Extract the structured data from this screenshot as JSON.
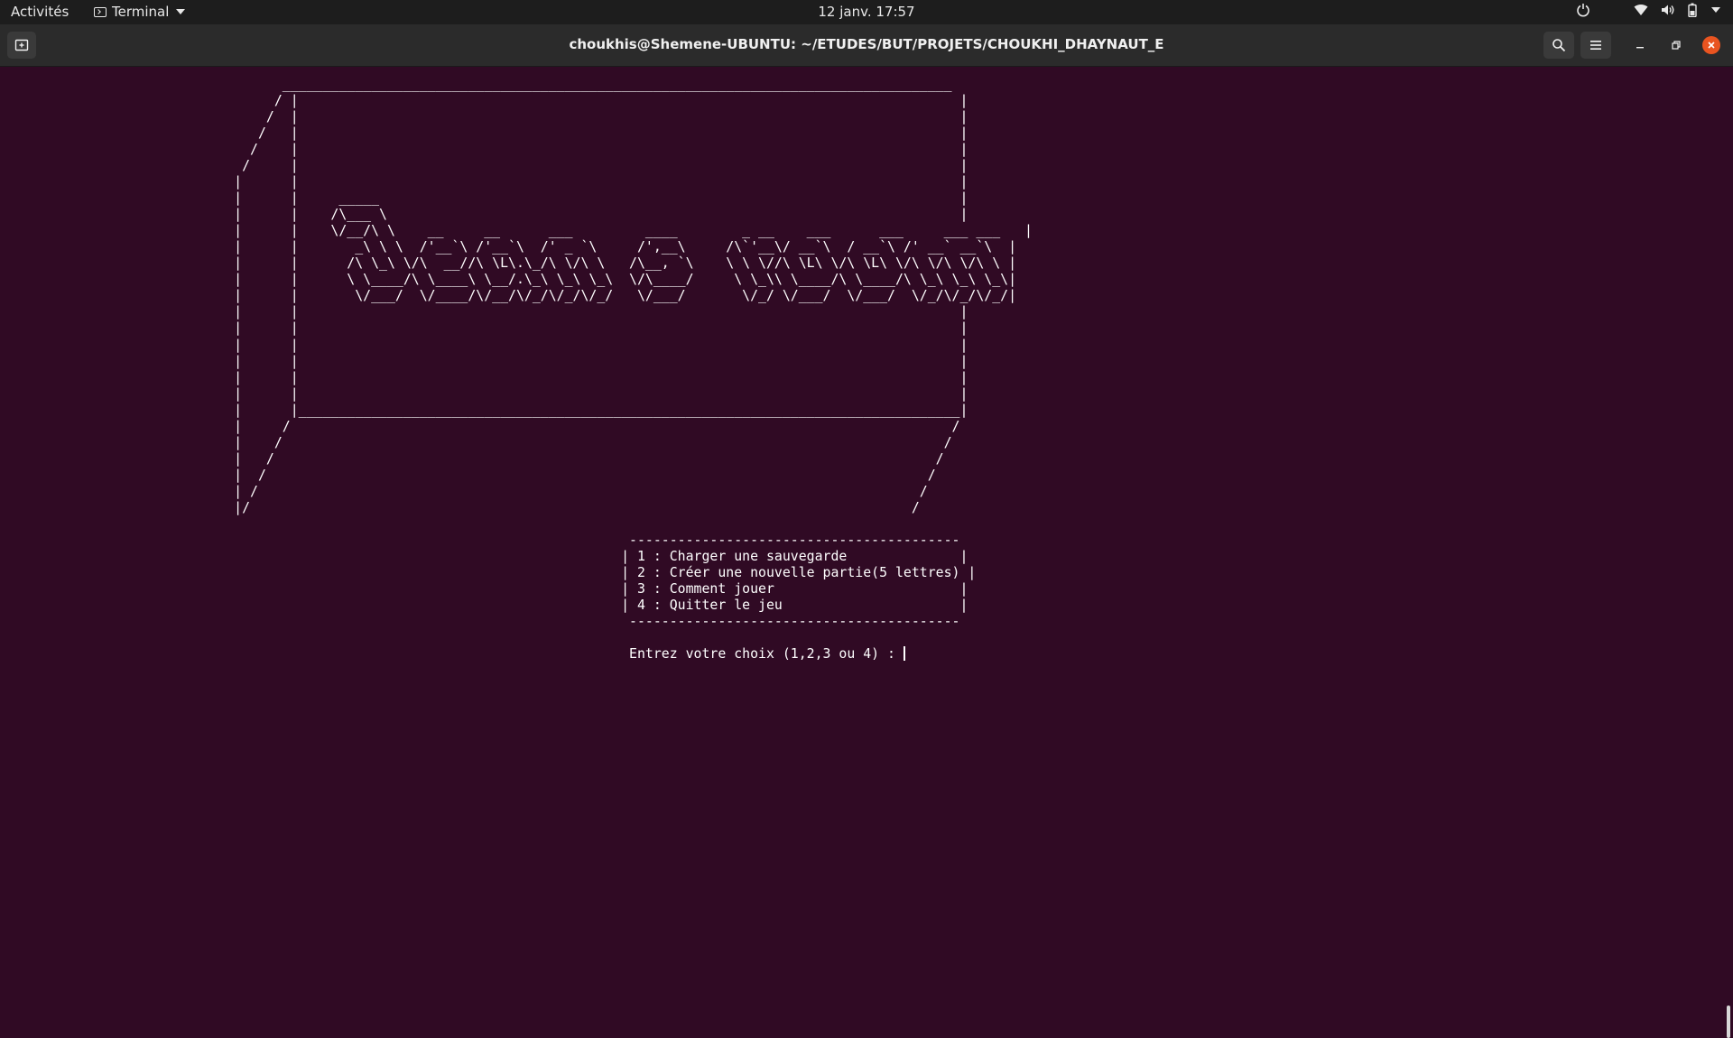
{
  "topbar": {
    "activities": "Activités",
    "app_name": "Terminal",
    "clock": "12 janv.  17:57",
    "icons": [
      "power-icon",
      "wifi-icon",
      "volume-icon",
      "battery-icon",
      "system-menu-chevron-icon"
    ]
  },
  "window": {
    "title": "choukhis@Shemene-UBUNTU: ~/ETUDES/BUT/PROJETS/CHOUKHI_DHAYNAUT_E",
    "close_color": "#e95420",
    "icons": [
      "new-tab-icon",
      "search-icon",
      "hamburger-menu-icon",
      "minimize-icon",
      "maximize-icon",
      "close-icon"
    ]
  },
  "terminal": {
    "background": "#300a24",
    "banner": "                                   ___________________________________________________________________________________\n                                  / |                                                                                  |\n                                 /  |                                                                                  |\n                                /   |                                                                                  |\n                               /    |                                                                                  |\n                              /     |                                                                                  |\n                             |      |                                                                                  |\n                             |      |     _____                                                                        |\n                             |      |    /\\___ \\                                                                       |\n                             |      |    \\/__/\\ \\    __     __      ___         ____        _ __    ___      ___     ___ ___   |\n                             |      |       _\\ \\ \\  /'__`\\ /'__`\\  /' _ `\\     /',__\\     /\\`'__\\/ __`\\  / __`\\ /' __` __`\\  |\n                             |      |      /\\ \\_\\ \\/\\  __//\\ \\L\\.\\_/\\ \\/\\ \\   /\\__, `\\    \\ \\ \\//\\ \\L\\ \\/\\ \\L\\ \\/\\ \\/\\ \\/\\ \\ |\n                             |      |      \\ \\____/\\ \\____\\ \\__/.\\_\\ \\_\\ \\_\\  \\/\\____/     \\ \\_\\\\ \\____/\\ \\____/\\ \\_\\ \\_\\ \\_\\|\n                             |      |       \\/___/  \\/____/\\/__/\\/_/\\/_/\\/_/   \\/___/       \\/_/ \\/___/  \\/___/  \\/_/\\/_/\\/_/|\n                             |      |                                                                                  |\n                             |      |                                                                                  |\n                             |      |                                                                                  |\n                             |      |                                                                                  |\n                             |      |                                                                                  |\n                             |      |                                                                                  |\n                             |      |__________________________________________________________________________________|\n                             |     /                                                                                  /\n                             |    /                                                                                  /\n                             |   /                                                                                  /\n                             |  /                                                                                  /\n                             | /                                                                                  /\n                             |/                                                                                  /",
    "menu": [
      "                                                                              -----------------------------------------",
      "                                                                             | 1 : Charger une sauvegarde              |",
      "                                                                             | 2 : Créer une nouvelle partie(5 lettres) |",
      "                                                                             | 3 : Comment jouer                       |",
      "                                                                             | 4 : Quitter le jeu                      |",
      "                                                                              -----------------------------------------"
    ],
    "prompt": "                                                                              Entrez votre choix (1,2,3 ou 4) : "
  }
}
